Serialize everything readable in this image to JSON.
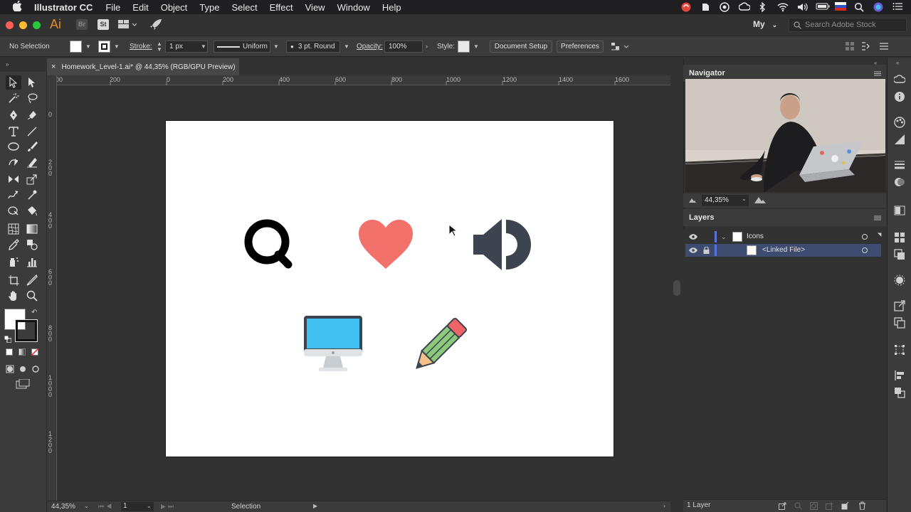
{
  "menubar": {
    "app_name": "Illustrator CC",
    "menus": [
      "File",
      "Edit",
      "Object",
      "Type",
      "Select",
      "Effect",
      "View",
      "Window",
      "Help"
    ]
  },
  "appbar": {
    "logo": "Ai",
    "bridge": "Br",
    "stock": "St",
    "workspace": "My",
    "search_placeholder": "Search Adobe Stock"
  },
  "control": {
    "selection": "No Selection",
    "stroke_label": "Stroke:",
    "stroke_value": "1 px",
    "profile": "Uniform",
    "brush": "3 pt. Round",
    "opacity_label": "Opacity:",
    "opacity_value": "100%",
    "style_label": "Style:",
    "document_setup": "Document Setup",
    "preferences": "Preferences"
  },
  "document": {
    "tab_title": "Homework_Level-1.ai* @ 44,35% (RGB/GPU Preview)",
    "ruler_top": [
      "00",
      "200",
      "0",
      "200",
      "400",
      "600",
      "800",
      "1000",
      "1200",
      "1400",
      "1600"
    ],
    "ruler_left": [
      "0",
      "2\n0\n0",
      "4\n0\n0",
      "6\n0\n0",
      "8\n0\n0",
      "1\n0\n0\n0",
      "1\n2\n0\n0"
    ]
  },
  "status": {
    "zoom": "44,35%",
    "artboard": "1",
    "tool": "Selection"
  },
  "navigator": {
    "title": "Navigator",
    "zoom": "44,35%"
  },
  "layers": {
    "title": "Layers",
    "rows": [
      {
        "name": "Icons"
      },
      {
        "name": "<Linked File>"
      }
    ],
    "count": "1 Layer"
  },
  "colors": {
    "heart": "#f2716b",
    "speaker": "#3c4450",
    "monitor_screen": "#3fc0f0",
    "pencil_body": "#8cc97a",
    "pencil_eraser": "#ef6466",
    "accent_selected": "#3c4b6e"
  }
}
